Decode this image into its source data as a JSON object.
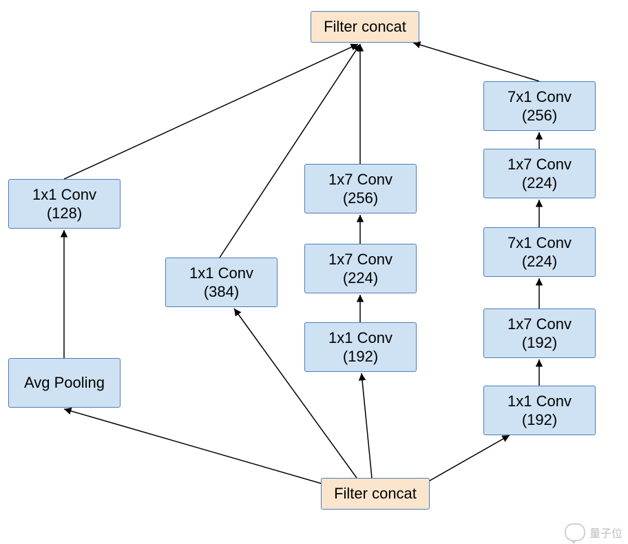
{
  "nodes": {
    "filter_concat_top": {
      "label": "Filter concat"
    },
    "filter_concat_bottom": {
      "label": "Filter concat"
    },
    "conv_1x1_128": {
      "line1": "1x1 Conv",
      "line2": "(128)"
    },
    "avg_pooling": {
      "label": "Avg Pooling"
    },
    "conv_1x1_384": {
      "line1": "1x1 Conv",
      "line2": "(384)"
    },
    "b3_1x7_256": {
      "line1": "1x7 Conv",
      "line2": "(256)"
    },
    "b3_1x7_224": {
      "line1": "1x7 Conv",
      "line2": "(224)"
    },
    "b3_1x1_192": {
      "line1": "1x1 Conv",
      "line2": "(192)"
    },
    "b4_7x1_256": {
      "line1": "7x1 Conv",
      "line2": "(256)"
    },
    "b4_1x7_224": {
      "line1": "1x7 Conv",
      "line2": "(224)"
    },
    "b4_7x1_224": {
      "line1": "7x1 Conv",
      "line2": "(224)"
    },
    "b4_1x7_192": {
      "line1": "1x7 Conv",
      "line2": "(192)"
    },
    "b4_1x1_192": {
      "line1": "1x1 Conv",
      "line2": "(192)"
    }
  },
  "colors": {
    "blue": "#cfe2f3",
    "orange": "#fce5cd",
    "border": "#4a7db8",
    "arrow": "#000000"
  },
  "watermark": {
    "text": "量子位"
  }
}
